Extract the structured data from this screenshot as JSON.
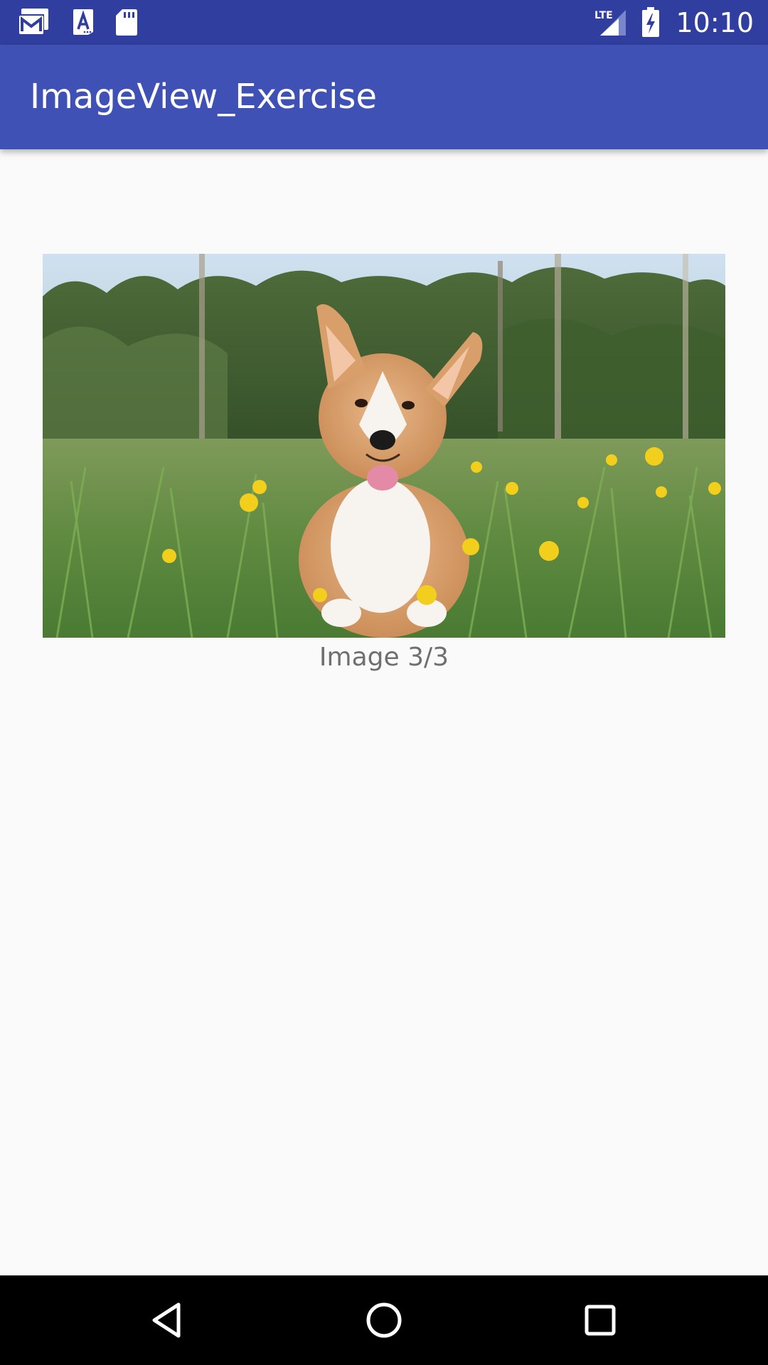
{
  "status_bar": {
    "time": "10:10",
    "network": "LTE",
    "icons": [
      "gmail-icon",
      "app-store-icon",
      "sd-card-icon",
      "signal-icon",
      "battery-charging-icon"
    ]
  },
  "app_bar": {
    "title": "ImageView_Exercise"
  },
  "main": {
    "image_alt": "corgi-dog-in-dandelion-field",
    "caption": "Image 3/3"
  },
  "nav_bar": {
    "buttons": [
      "back-button",
      "home-button",
      "recents-button"
    ]
  },
  "colors": {
    "status_bar": "#303F9F",
    "app_bar": "#3F51B5",
    "background": "#FAFAFA",
    "caption_text": "#6f6f6f",
    "nav_bar": "#000000"
  }
}
